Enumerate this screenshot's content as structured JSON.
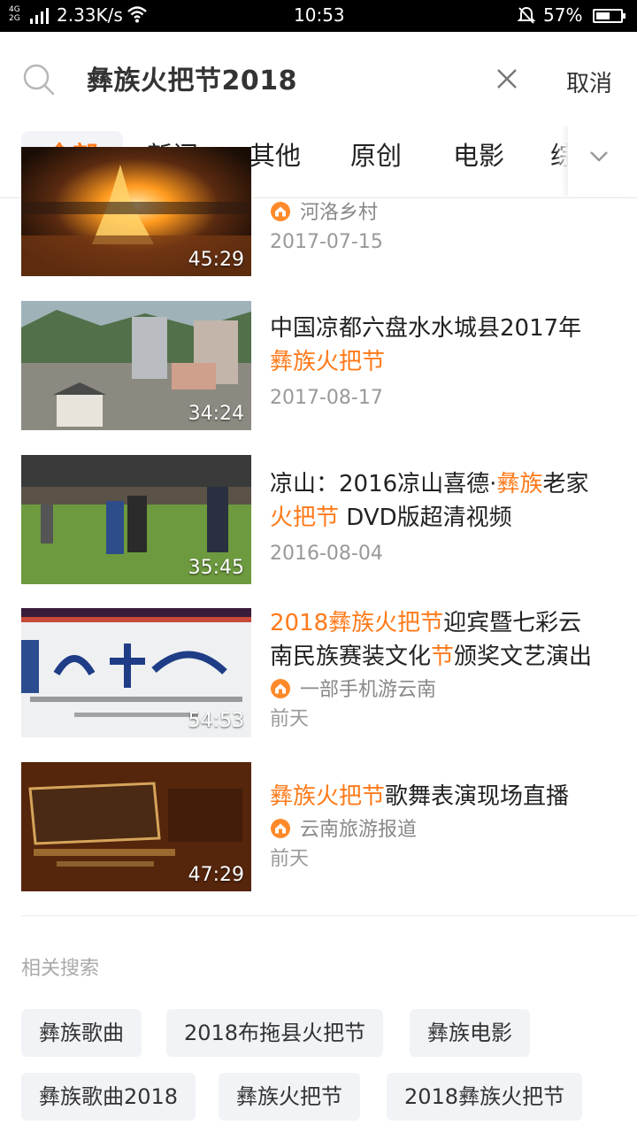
{
  "status_bar": {
    "network": "4G 2G",
    "speed": "2.33K/s",
    "time": "10:53",
    "battery_pct": "57%",
    "battery_level": 0.57
  },
  "search": {
    "query": "彝族火把节2018",
    "cancel_label": "取消"
  },
  "tabs": [
    {
      "label": "全部",
      "active": true
    },
    {
      "label": "新闻",
      "active": false
    },
    {
      "label": "其他",
      "active": false
    },
    {
      "label": "原创",
      "active": false
    },
    {
      "label": "电影",
      "active": false
    },
    {
      "label": "综",
      "active": false
    }
  ],
  "results": [
    {
      "duration": "45:29",
      "title_parts": [],
      "source": "河洛乡村",
      "date": "2017-07-15"
    },
    {
      "duration": "34:24",
      "title_line1": "中国凉都六盘水水城县2017年",
      "title_hl": "彝族火把节",
      "date": "2017-08-17"
    },
    {
      "duration": "35:45",
      "title_a": "凉山：2016凉山喜德·",
      "title_hl_a": "彝族",
      "title_b": "老家",
      "title_hl_b": "火把节",
      "title_c": " DVD版超清视频",
      "date": "2016-08-04"
    },
    {
      "duration": "54:53",
      "title_hl_a": "2018彝族火把节",
      "title_a": "迎宾暨七彩云",
      "title_b": "南民族赛装文化",
      "title_hl_b": "节",
      "title_c": "颁奖文艺演出",
      "source": "一部手机游云南",
      "date": "前天"
    },
    {
      "duration": "47:29",
      "title_hl": "彝族火把节",
      "title_rest": "歌舞表演现场直播",
      "source": "云南旅游报道",
      "date": "前天"
    }
  ],
  "related": {
    "title": "相关搜索",
    "chips": [
      "彝族歌曲",
      "2018布拖县火把节",
      "彝族电影",
      "彝族歌曲2018",
      "彝族火把节",
      "2018彝族火把节"
    ]
  },
  "colors": {
    "accent": "#ff7a1a",
    "chip_bg": "#f1f3f6"
  }
}
